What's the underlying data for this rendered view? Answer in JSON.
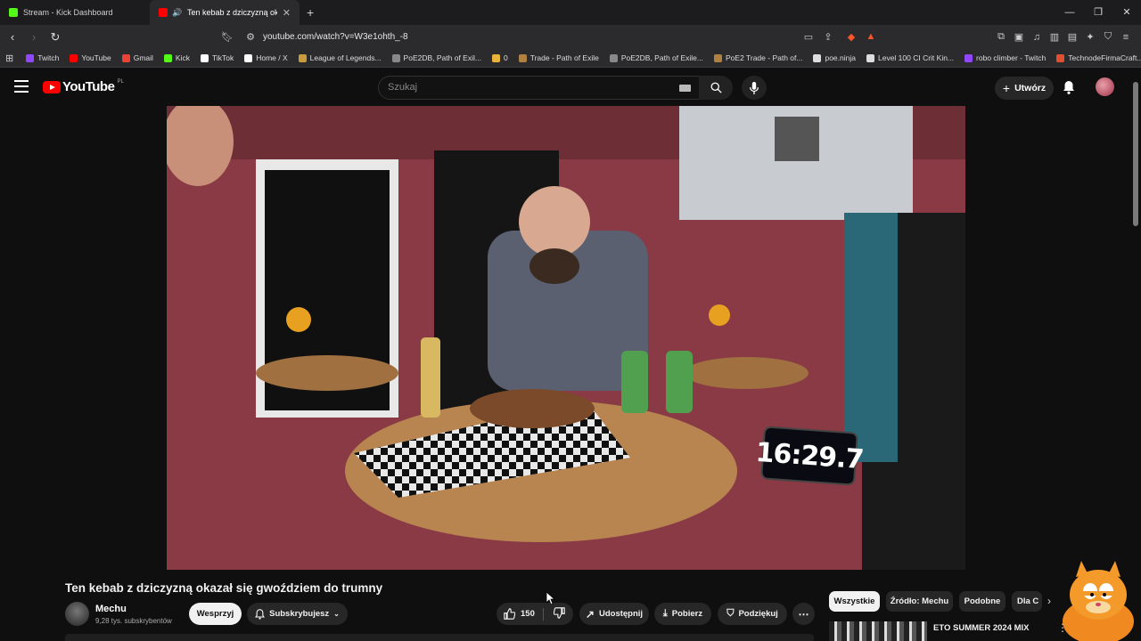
{
  "browser": {
    "tabs": [
      {
        "title": "Stream - Kick Dashboard",
        "favicon_color": "#53fc18",
        "active": false
      },
      {
        "title": "Ten kebab z dziczyzną okazał",
        "favicon_color": "#ff0000",
        "active": true
      }
    ],
    "new_tab_label": "+",
    "url": "youtube.com/watch?v=W3e1ohth_-8",
    "bookmarks": [
      {
        "label": "Twitch",
        "color": "#9146ff"
      },
      {
        "label": "YouTube",
        "color": "#ff0000"
      },
      {
        "label": "Gmail",
        "color": "#ea4335"
      },
      {
        "label": "Kick",
        "color": "#53fc18"
      },
      {
        "label": "TikTok",
        "color": "#ffffff"
      },
      {
        "label": "Home / X",
        "color": "#ffffff"
      },
      {
        "label": "League of Legends...",
        "color": "#c89b3c"
      },
      {
        "label": "PoE2DB, Path of Exil...",
        "color": "#888888"
      },
      {
        "label": "0",
        "color": "#e8b339"
      },
      {
        "label": "Trade - Path of Exile",
        "color": "#b08040"
      },
      {
        "label": "PoE2DB, Path of Exile...",
        "color": "#888888"
      },
      {
        "label": "PoE2 Trade - Path of...",
        "color": "#b08040"
      },
      {
        "label": "poe.ninja",
        "color": "#dddddd"
      },
      {
        "label": "Level 100 CI Crit Kin...",
        "color": "#dddddd"
      },
      {
        "label": "robo climber - Twitch",
        "color": "#9146ff"
      },
      {
        "label": "TechnodeFirmaCraft...",
        "color": "#e05030"
      }
    ],
    "overflow_label": "»"
  },
  "youtube": {
    "logo_text": "YouTube",
    "region": "PL",
    "search_placeholder": "Szukaj",
    "create_label": "Utwórz",
    "video": {
      "timer_display": "16:29.7",
      "title": "Ten kebab z dziczyzną okazał się gwoździem do trumny",
      "channel_name": "Mechu",
      "subscribers": "9,28 tys. subskrybentów",
      "support_label": "Wesprzyj",
      "subscribed_label": "Subskrybujesz",
      "likes": "150",
      "share_label": "Udostępnij",
      "download_label": "Pobierz",
      "thanks_label": "Podziękuj"
    },
    "chips": [
      {
        "label": "Wszystkie",
        "active": true
      },
      {
        "label": "Źródło: Mechu",
        "active": false
      },
      {
        "label": "Podobne",
        "active": false
      },
      {
        "label": "Dla C",
        "active": false
      }
    ],
    "recommendation": {
      "title": "ETO SUMMER 2024 MIX"
    }
  },
  "colors": {
    "accent": "#ff0000",
    "background": "#0f0f0f",
    "chip_bg": "#272727"
  }
}
